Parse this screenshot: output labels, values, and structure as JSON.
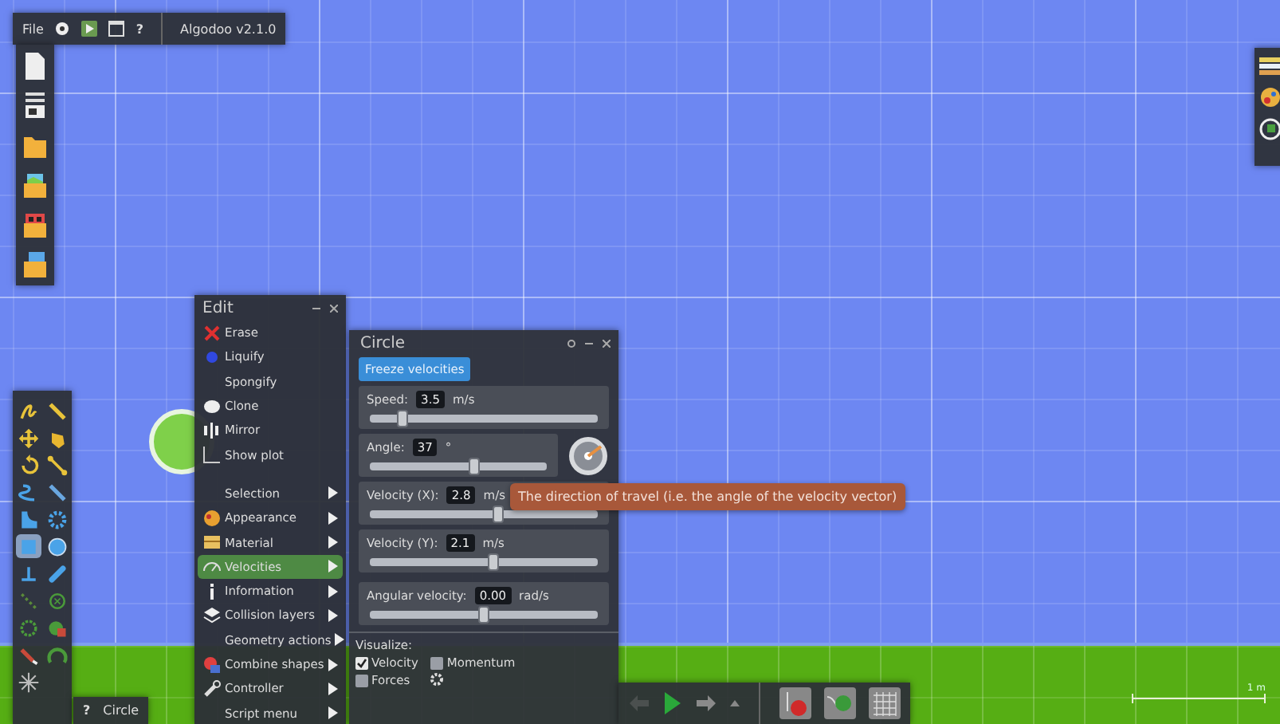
{
  "menubar": {
    "file": "File",
    "help": "?",
    "version": "Algodoo v2.1.0"
  },
  "toolbox": {
    "tools": [
      {
        "selected": false
      },
      {
        "selected": false
      },
      {
        "selected": false
      },
      {
        "selected": false
      },
      {
        "selected": false
      },
      {
        "selected": false
      },
      {
        "selected": false
      },
      {
        "selected": false
      },
      {
        "selected": false
      },
      {
        "selected": false
      },
      {
        "selected": true
      },
      {
        "selected": false
      },
      {
        "selected": false
      },
      {
        "selected": false
      },
      {
        "selected": false
      },
      {
        "selected": false
      },
      {
        "selected": false
      },
      {
        "selected": false
      },
      {
        "selected": false
      }
    ]
  },
  "status": {
    "help": "?",
    "tool": "Circle"
  },
  "edit_menu": {
    "title": "Edit",
    "items": [
      {
        "label": "Erase",
        "kind": "action",
        "selected": false
      },
      {
        "label": "Liquify",
        "kind": "action",
        "selected": false
      },
      {
        "label": "Spongify",
        "kind": "action",
        "selected": false
      },
      {
        "label": "Clone",
        "kind": "action",
        "selected": false
      },
      {
        "label": "Mirror",
        "kind": "action",
        "selected": false
      },
      {
        "label": "Show plot",
        "kind": "action",
        "selected": false
      },
      {
        "label": "Selection",
        "kind": "submenu",
        "selected": false
      },
      {
        "label": "Appearance",
        "kind": "submenu",
        "selected": false
      },
      {
        "label": "Material",
        "kind": "submenu",
        "selected": false
      },
      {
        "label": "Velocities",
        "kind": "submenu",
        "selected": true
      },
      {
        "label": "Information",
        "kind": "submenu",
        "selected": false
      },
      {
        "label": "Collision layers",
        "kind": "submenu",
        "selected": false
      },
      {
        "label": "Geometry actions",
        "kind": "submenu",
        "selected": false
      },
      {
        "label": "Combine shapes",
        "kind": "submenu",
        "selected": false
      },
      {
        "label": "Controller",
        "kind": "submenu",
        "selected": false
      },
      {
        "label": "Script menu",
        "kind": "submenu",
        "selected": false
      }
    ]
  },
  "circle_panel": {
    "title": "Circle",
    "freeze_button": "Freeze velocities",
    "sliders": [
      {
        "label": "Speed:",
        "value": "3.5",
        "unit": "m/s",
        "level": 0.14,
        "dial": false
      },
      {
        "label": "Angle:",
        "value": "37",
        "unit": "°",
        "level": 0.59,
        "dial": true
      },
      {
        "label": "Velocity (X):",
        "value": "2.8",
        "unit": "m/s",
        "level": 0.56,
        "dial": false
      },
      {
        "label": "Velocity (Y):",
        "value": "2.1",
        "unit": "m/s",
        "level": 0.54,
        "dial": false
      },
      {
        "label": "Angular velocity:",
        "value": "0.00",
        "unit": "rad/s",
        "level": 0.5,
        "dial": false
      }
    ],
    "visualize": {
      "label": "Visualize:",
      "options": [
        {
          "label": "Velocity",
          "checked": true
        },
        {
          "label": "Momentum",
          "checked": false
        },
        {
          "label": "Forces",
          "checked": false
        }
      ]
    }
  },
  "tooltip": "The direction of travel (i.e. the angle of the velocity vector)",
  "scale": "1 m"
}
